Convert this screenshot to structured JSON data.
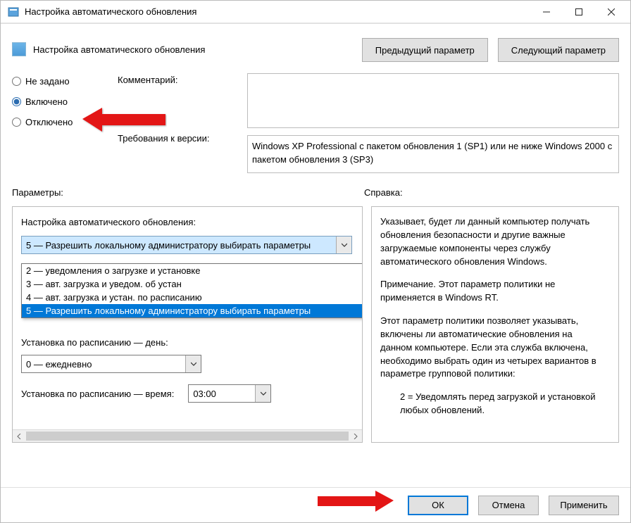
{
  "window": {
    "title": "Настройка автоматического обновления"
  },
  "header": {
    "title": "Настройка автоматического обновления",
    "prev": "Предыдущий параметр",
    "next": "Следующий параметр"
  },
  "state": {
    "not_configured": "Не задано",
    "enabled": "Включено",
    "disabled": "Отключено",
    "selected": "enabled"
  },
  "labels": {
    "comment": "Комментарий:",
    "requirements": "Требования к версии:",
    "parameters": "Параметры:",
    "help": "Справка:",
    "config_update": "Настройка автоматического обновления:",
    "sched_day": "Установка по расписанию — день:",
    "sched_time": "Установка по расписанию — время:"
  },
  "fields": {
    "comment_value": "",
    "requirements_value": "Windows XP Professional с пакетом обновления 1 (SP1) или не ниже Windows 2000 с пакетом обновления 3 (SP3)"
  },
  "config_combo": {
    "selected": "5 — Разрешить локальному администратору выбирать параметры",
    "options": [
      "2 — уведомления о загрузке и установке",
      "3 — авт. загрузка и уведом. об устан",
      "4 — авт. загрузка и устан. по расписанию",
      "5 — Разрешить локальному администратору выбирать параметры"
    ]
  },
  "day_combo": {
    "selected": "0 — ежедневно"
  },
  "time_combo": {
    "selected": "03:00"
  },
  "help_text": {
    "p1": "Указывает, будет ли данный компьютер получать обновления безопасности и другие важные загружаемые компоненты через службу автоматического обновления Windows.",
    "p2": "Примечание. Этот параметр политики не применяется в Windows RT.",
    "p3": "Этот параметр политики позволяет указывать, включены ли автоматические обновления на данном компьютере. Если эта служба включена, необходимо выбрать один из четырех вариантов в параметре групповой политики:",
    "p4": "2 = Уведомлять перед загрузкой и установкой любых обновлений."
  },
  "footer": {
    "ok": "ОК",
    "cancel": "Отмена",
    "apply": "Применить"
  }
}
